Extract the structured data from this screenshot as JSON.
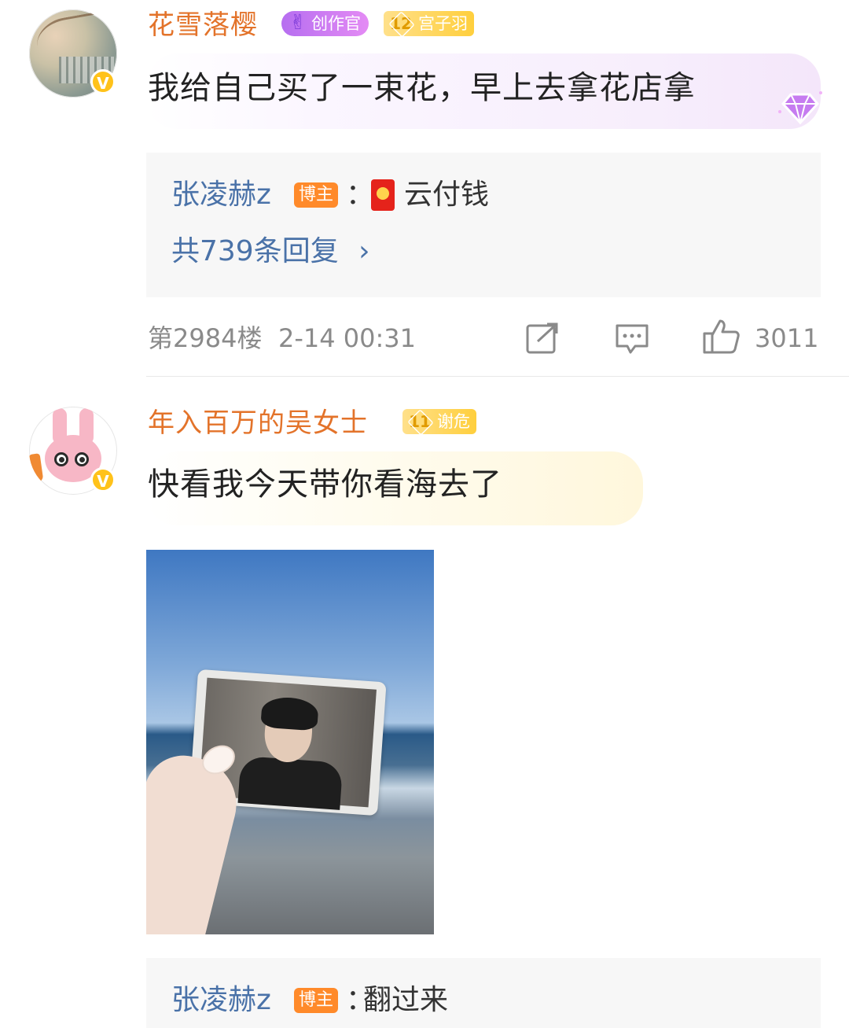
{
  "comments": [
    {
      "username": "花雪落樱",
      "creator_badge": "创作官",
      "level_num": "12",
      "level_title": "宫子羽",
      "text": "我给自己买了一束花，早上去拿花店拿",
      "reply": {
        "author": "张凌赫z",
        "author_tag": "博主",
        "separator": "：",
        "text": "云付钱",
        "more_label": "共739条回复",
        "more_chevron": "›"
      },
      "meta": {
        "floor": "第2984楼",
        "time": "2-14 00:31",
        "like_count": "3011"
      }
    },
    {
      "username": "年入百万的吴女士",
      "level_num": "11",
      "level_title": "谢危",
      "text": "快看我今天带你看海去了",
      "reply": {
        "author": "张凌赫z",
        "author_tag": "博主",
        "separator": "：",
        "text": "翻过来"
      }
    }
  ],
  "icons": {
    "verified": "V",
    "creator": "✌",
    "hongbao": "hongbao-icon",
    "repost": "repost-icon",
    "comment": "comment-icon",
    "like": "like-icon",
    "gem": "gem-icon"
  },
  "colors": {
    "username": "#e3732a",
    "reply_link": "#4a72a8",
    "blogger_tag": "#ff8a2a",
    "verified": "#ffc21a",
    "meta": "#8a8a8a"
  }
}
